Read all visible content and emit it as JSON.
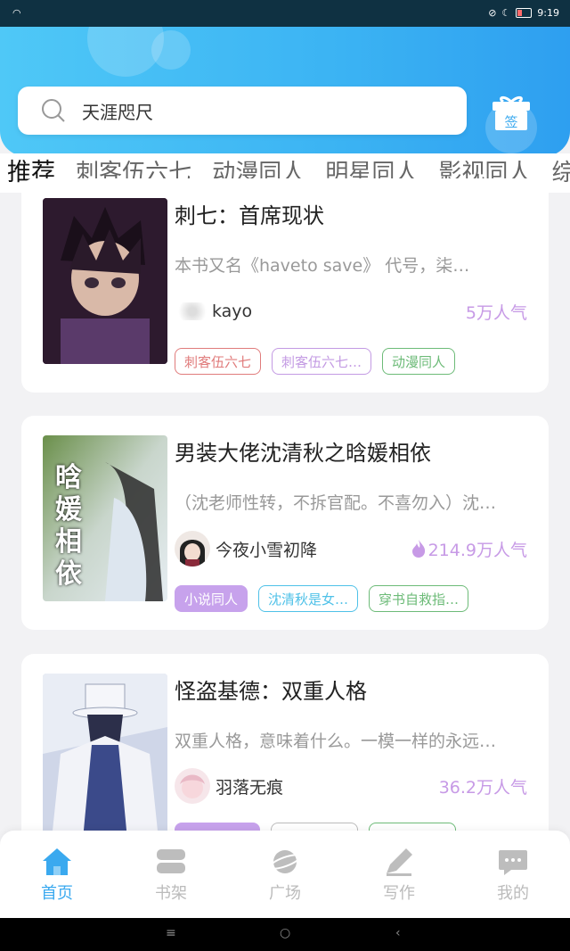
{
  "status_bar": {
    "time": "9:19"
  },
  "search": {
    "query": "天涯咫尺"
  },
  "gift": {
    "label": "签"
  },
  "tabs": [
    "推荐",
    "刺客伍六七",
    "动漫同人",
    "明星同人",
    "影视同人",
    "综"
  ],
  "books": [
    {
      "title": "刺七：首席现状",
      "desc": "本书又名《haveto save》     代号，柒…",
      "author": "kayo",
      "popularity": "5万人气",
      "tags": [
        {
          "label": "刺客伍六七",
          "color": "#e07b7b"
        },
        {
          "label": "刺客伍六七…",
          "color": "#c39ae3"
        },
        {
          "label": "动漫同人",
          "color": "#6dbb78"
        }
      ]
    },
    {
      "title": "男装大佬沈清秋之晗媛相依",
      "desc": "（沈老师性转，不拆官配。不喜勿入）沈…",
      "author": "今夜小雪初降",
      "popularity": "214.9万人气",
      "cover_text": "晗媛相依",
      "tags": [
        {
          "label": "小说同人",
          "color": "#b58be0"
        },
        {
          "label": "沈清秋是女…",
          "color": "#4fc1e8"
        },
        {
          "label": "穿书自救指…",
          "color": "#6dbb78"
        }
      ]
    },
    {
      "title": "怪盗基德：双重人格",
      "desc": "双重人格，意味着什么。一模一样的永远…",
      "author": "羽落无痕",
      "popularity": "36.2万人气",
      "tags": [
        {
          "label": "",
          "color": "#b58be0"
        },
        {
          "label": "",
          "color": "#999999"
        },
        {
          "label": "",
          "color": "#6dbb78"
        }
      ]
    }
  ],
  "bottom_nav": [
    {
      "label": "首页",
      "icon": "home-icon",
      "active": true
    },
    {
      "label": "书架",
      "icon": "bookshelf-icon",
      "active": false
    },
    {
      "label": "广场",
      "icon": "planet-icon",
      "active": false
    },
    {
      "label": "写作",
      "icon": "write-icon",
      "active": false
    },
    {
      "label": "我的",
      "icon": "profile-chat-icon",
      "active": false
    }
  ],
  "colors": {
    "accent": "#3aa9ef",
    "popularity": "#c79ae6"
  }
}
